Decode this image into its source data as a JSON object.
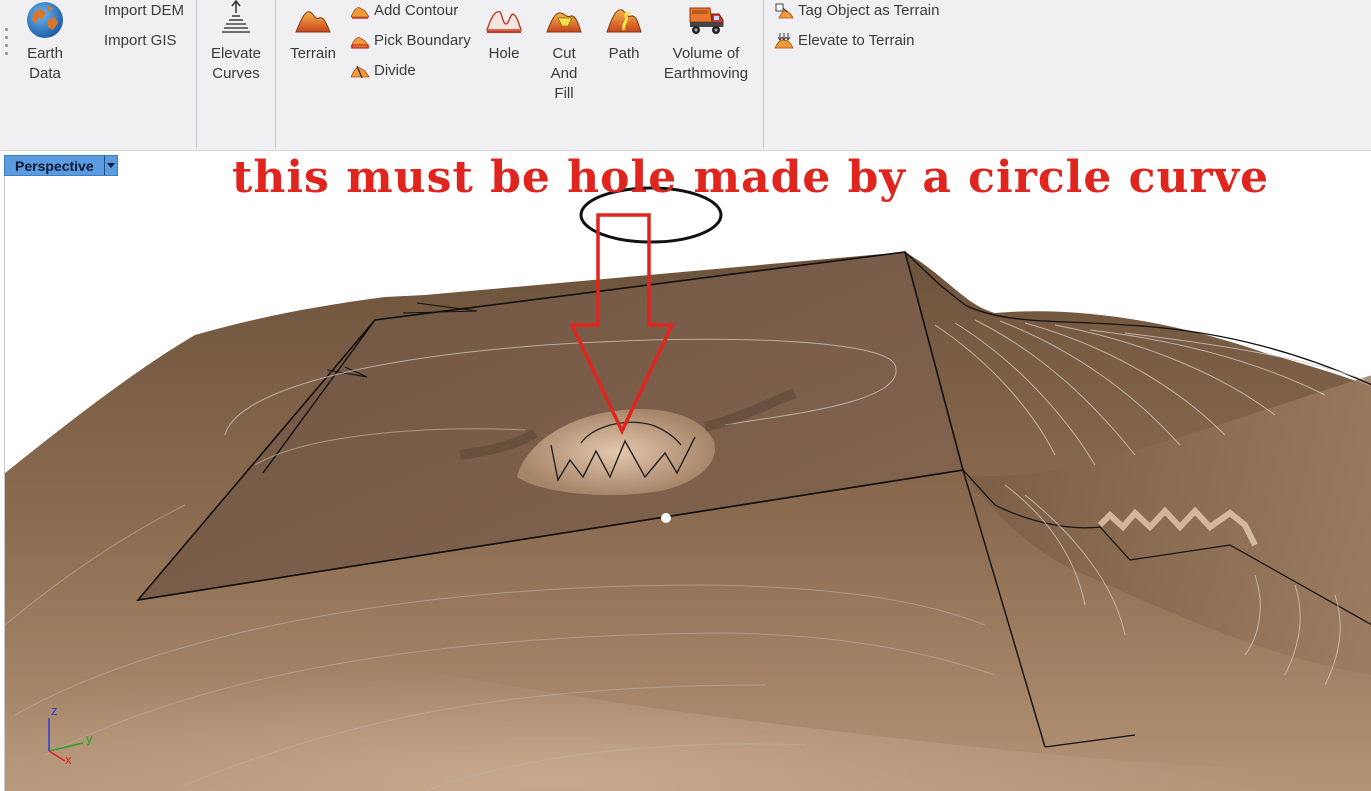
{
  "ribbon": {
    "earth_data": "Earth\nData",
    "import_dem": "Import DEM",
    "import_gis": "Import GIS",
    "elevate_curves": "Elevate\nCurves",
    "terrain": "Terrain",
    "add_contour": "Add Contour",
    "pick_boundary": "Pick Boundary",
    "divide": "Divide",
    "hole": "Hole",
    "cut_and_fill": "Cut\nAnd\nFill",
    "path": "Path",
    "volume_of_earthmoving": "Volume of\nEarthmoving",
    "tag_object_as_terrain": "Tag Object as Terrain",
    "elevate_to_terrain": "Elevate to Terrain"
  },
  "viewport": {
    "name": "Perspective",
    "annotation_text": "this must be hole made by a circle curve",
    "axes": {
      "z": "z",
      "y": "y",
      "x": "x"
    }
  },
  "colors": {
    "annotation": "#e0241e",
    "terrain_base": "#8a6a4e",
    "terrain_plate": "#7b5f48",
    "tab_bg": "#5b9be0"
  },
  "icons": [
    "globe-icon",
    "elevate-curves-icon",
    "terrain-icon",
    "add-contour-icon",
    "pick-boundary-icon",
    "divide-icon",
    "hole-icon",
    "cut-fill-icon",
    "path-icon",
    "dump-truck-icon",
    "tag-terrain-icon",
    "elevate-terrain-icon"
  ]
}
